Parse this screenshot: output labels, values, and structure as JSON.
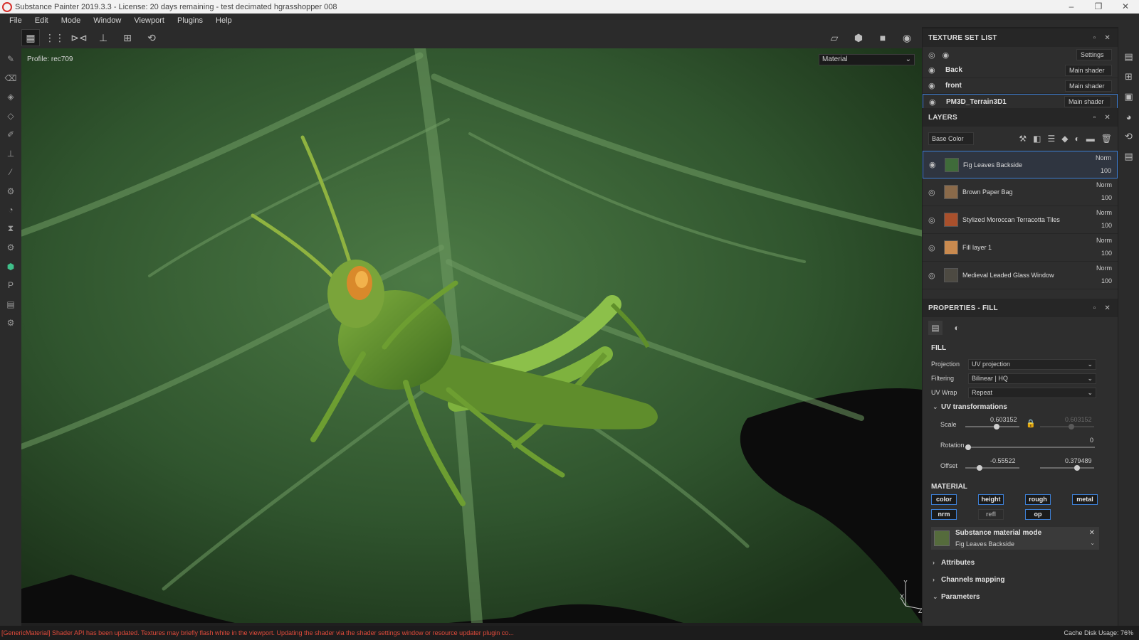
{
  "window": {
    "title": "Substance Painter 2019.3.3 - License: 20 days remaining - test decimated hgrasshopper 008",
    "controls": [
      "–",
      "❐",
      "✕"
    ]
  },
  "menu": [
    "File",
    "Edit",
    "Mode",
    "Window",
    "Viewport",
    "Plugins",
    "Help"
  ],
  "viewport": {
    "profile": "Profile: rec709",
    "display_mode": "Material",
    "axis_labels": [
      "Y",
      "X",
      "Z"
    ]
  },
  "texture_set_list": {
    "title": "TEXTURE SET LIST",
    "settings_label": "Settings",
    "items": [
      {
        "name": "Back",
        "shader": "Main shader"
      },
      {
        "name": "front",
        "shader": "Main shader"
      },
      {
        "name": "PM3D_Terrain3D1",
        "shader": "Main shader"
      }
    ]
  },
  "layers": {
    "title": "LAYERS",
    "channel": "Base Color",
    "items": [
      {
        "name": "Fig Leaves Backside",
        "blend": "Norm",
        "opacity": "100",
        "swatch": "#3f6b3a"
      },
      {
        "name": "Brown Paper Bag",
        "blend": "Norm",
        "opacity": "100",
        "swatch": "#8a6a4a"
      },
      {
        "name": "Stylized Moroccan Terracotta Tiles",
        "blend": "Norm",
        "opacity": "100",
        "swatch": "#a9502c"
      },
      {
        "name": "Fill layer 1",
        "blend": "Norm",
        "opacity": "100",
        "swatch": "#c98a4f"
      },
      {
        "name": "Medieval Leaded Glass Window",
        "blend": "Norm",
        "opacity": "100",
        "swatch": "#4d4a42"
      }
    ]
  },
  "properties": {
    "title": "PROPERTIES - FILL",
    "fill_section": "FILL",
    "projection_label": "Projection",
    "projection_value": "UV projection",
    "filtering_label": "Filtering",
    "filtering_value": "Bilinear | HQ",
    "uvwrap_label": "UV Wrap",
    "uvwrap_value": "Repeat",
    "uv_transformations": "UV transformations",
    "scale_label": "Scale",
    "scale_value": "0.603152",
    "scale_value_locked": "0.603152",
    "rotation_label": "Rotation",
    "rotation_value": "0",
    "offset_label": "Offset",
    "offset_x": "-0.55522",
    "offset_y": "0.379489",
    "material_section": "MATERIAL",
    "material_channels": [
      "color",
      "height",
      "rough",
      "metal",
      "nrm",
      "refl",
      "op"
    ],
    "substance_mode_title": "Substance material mode",
    "substance_mode_name": "Fig Leaves Backside",
    "attributes": "Attributes",
    "channels_mapping": "Channels mapping",
    "parameters": "Parameters"
  },
  "status": {
    "message": "[GenericMaterial] Shader API has been updated. Textures may briefly flash white in the viewport. Updating the shader via the shader settings window or resource updater plugin co...",
    "cache": "Cache Disk Usage:   76%"
  },
  "colors": {
    "accent": "#3d7fd4",
    "error": "#e24b3b",
    "leaf": "#3f6b3a",
    "grasshopper": "#5e8f2e"
  }
}
